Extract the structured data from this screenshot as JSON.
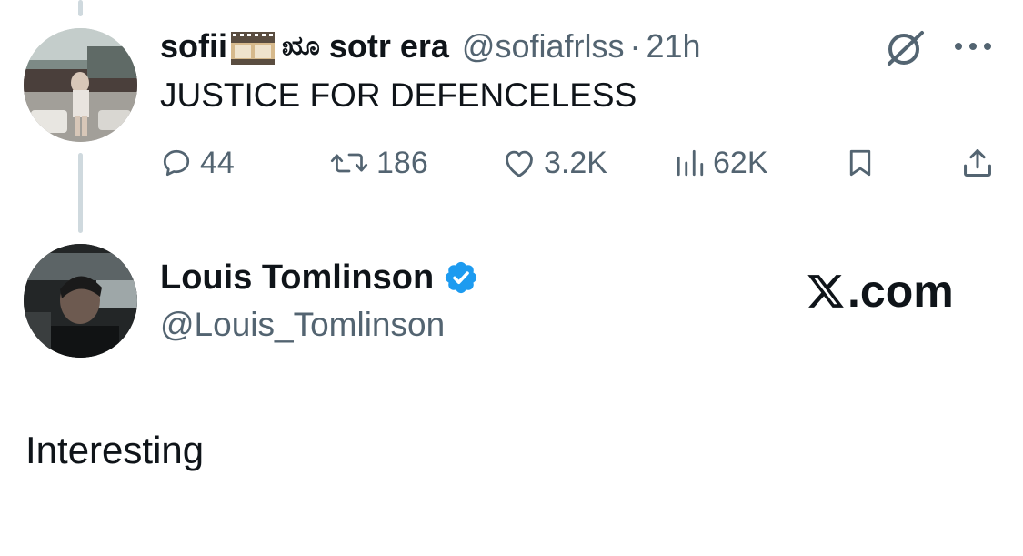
{
  "reply_tweet": {
    "display_name_part1": "sofii",
    "film_emoji": "film-frames-icon",
    "question_glyph": "ೠ",
    "display_name_part2": "sotr era",
    "handle": "@sofiafrlss",
    "separator": "·",
    "time": "21h",
    "text": "JUSTICE FOR DEFENCELESS",
    "actions": {
      "replies": "44",
      "retweets": "186",
      "likes": "3.2K",
      "views": "62K"
    }
  },
  "quoted_tweet": {
    "display_name": "Louis Tomlinson",
    "handle": "@Louis_Tomlinson",
    "text": "Interesting",
    "verified": true
  },
  "watermark": {
    "text": ".com"
  },
  "colors": {
    "text_primary": "#0f1419",
    "text_secondary": "#536471",
    "verified_blue": "#1d9bf0",
    "thread_line": "#cfd9de"
  }
}
